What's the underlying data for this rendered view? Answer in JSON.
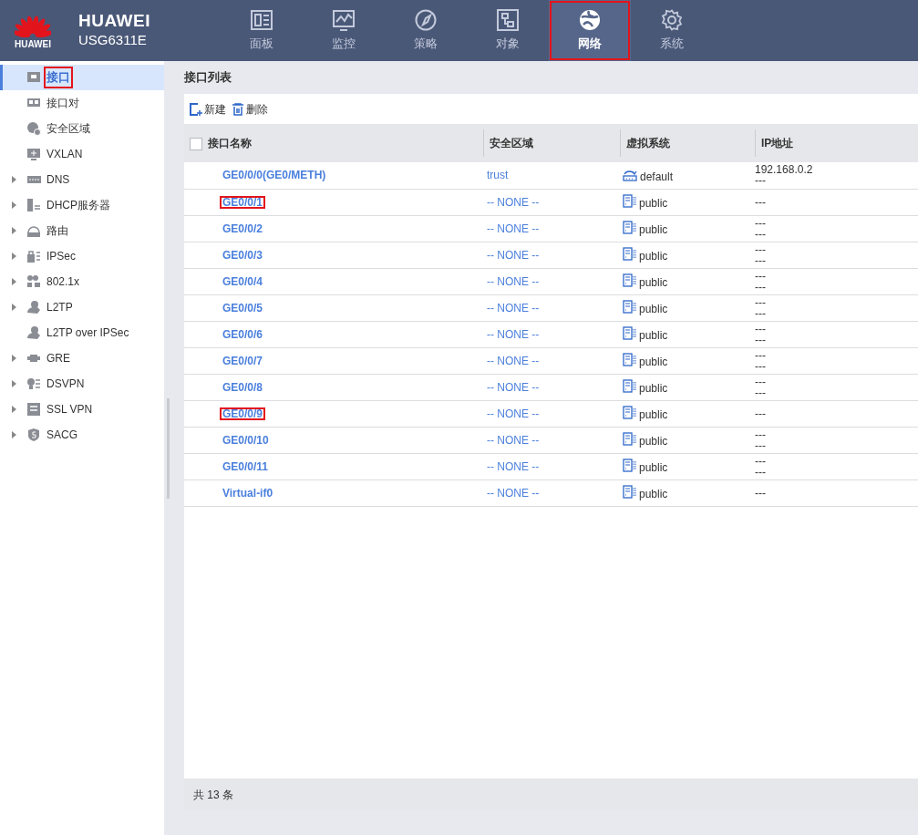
{
  "brand": {
    "logo_text": "HUAWEI",
    "name": "HUAWEI",
    "model": "USG6311E"
  },
  "nav": [
    {
      "label": "面板",
      "selected": false,
      "highlighted": false
    },
    {
      "label": "监控",
      "selected": false,
      "highlighted": false
    },
    {
      "label": "策略",
      "selected": false,
      "highlighted": false
    },
    {
      "label": "对象",
      "selected": false,
      "highlighted": false
    },
    {
      "label": "网络",
      "selected": true,
      "highlighted": true
    },
    {
      "label": "系统",
      "selected": false,
      "highlighted": false
    }
  ],
  "sidebar": {
    "items": [
      {
        "label": "接口",
        "kind": "item",
        "selected": true,
        "highlighted": true
      },
      {
        "label": "接口对",
        "kind": "item",
        "selected": false,
        "highlighted": false
      },
      {
        "label": "安全区域",
        "kind": "item",
        "selected": false,
        "highlighted": false
      },
      {
        "label": "VXLAN",
        "kind": "item",
        "selected": false,
        "highlighted": false
      },
      {
        "label": "DNS",
        "kind": "group",
        "expanded": false,
        "selected": false,
        "highlighted": false
      },
      {
        "label": "DHCP服务器",
        "kind": "group",
        "expanded": false,
        "selected": false,
        "highlighted": false
      },
      {
        "label": "路由",
        "kind": "group",
        "expanded": false,
        "selected": false,
        "highlighted": false
      },
      {
        "label": "IPSec",
        "kind": "group",
        "expanded": false,
        "selected": false,
        "highlighted": false
      },
      {
        "label": "802.1x",
        "kind": "group",
        "expanded": false,
        "selected": false,
        "highlighted": false
      },
      {
        "label": "L2TP",
        "kind": "group",
        "expanded": false,
        "selected": false,
        "highlighted": false
      },
      {
        "label": "L2TP over IPSec",
        "kind": "item",
        "selected": false,
        "highlighted": false
      },
      {
        "label": "GRE",
        "kind": "group",
        "expanded": false,
        "selected": false,
        "highlighted": false
      },
      {
        "label": "DSVPN",
        "kind": "group",
        "expanded": false,
        "selected": false,
        "highlighted": false
      },
      {
        "label": "SSL VPN",
        "kind": "group",
        "expanded": false,
        "selected": false,
        "highlighted": false
      },
      {
        "label": "SACG",
        "kind": "group",
        "expanded": false,
        "selected": false,
        "highlighted": false
      }
    ]
  },
  "panel": {
    "title": "接口列表",
    "toolbar": [
      "新建",
      "删除"
    ],
    "table": {
      "select_all": {
        "checked": false
      },
      "columns": [
        "接口名称",
        "安全区域",
        "虚拟系统",
        "IP地址"
      ],
      "rows": [
        {
          "name": "GE0/0/0(GE0/METH)",
          "zone": "trust",
          "vsys": "default",
          "kind": "root",
          "ip": [
            "192.168.0.2",
            "---"
          ],
          "highlighted": false
        },
        {
          "name": "GE0/0/1",
          "zone": "-- NONE --",
          "vsys": "public",
          "kind": "vsys",
          "ip": [
            "---"
          ],
          "highlighted": true
        },
        {
          "name": "GE0/0/2",
          "zone": "-- NONE --",
          "vsys": "public",
          "kind": "vsys",
          "ip": [
            "---",
            "---"
          ],
          "highlighted": false
        },
        {
          "name": "GE0/0/3",
          "zone": "-- NONE --",
          "vsys": "public",
          "kind": "vsys",
          "ip": [
            "---",
            "---"
          ],
          "highlighted": false
        },
        {
          "name": "GE0/0/4",
          "zone": "-- NONE --",
          "vsys": "public",
          "kind": "vsys",
          "ip": [
            "---",
            "---"
          ],
          "highlighted": false
        },
        {
          "name": "GE0/0/5",
          "zone": "-- NONE --",
          "vsys": "public",
          "kind": "vsys",
          "ip": [
            "---",
            "---"
          ],
          "highlighted": false
        },
        {
          "name": "GE0/0/6",
          "zone": "-- NONE --",
          "vsys": "public",
          "kind": "vsys",
          "ip": [
            "---",
            "---"
          ],
          "highlighted": false
        },
        {
          "name": "GE0/0/7",
          "zone": "-- NONE --",
          "vsys": "public",
          "kind": "vsys",
          "ip": [
            "---",
            "---"
          ],
          "highlighted": false
        },
        {
          "name": "GE0/0/8",
          "zone": "-- NONE --",
          "vsys": "public",
          "kind": "vsys",
          "ip": [
            "---",
            "---"
          ],
          "highlighted": false
        },
        {
          "name": "GE0/0/9",
          "zone": "-- NONE --",
          "vsys": "public",
          "kind": "vsys",
          "ip": [
            "---"
          ],
          "highlighted": true
        },
        {
          "name": "GE0/0/10",
          "zone": "-- NONE --",
          "vsys": "public",
          "kind": "vsys",
          "ip": [
            "---",
            "---"
          ],
          "highlighted": false
        },
        {
          "name": "GE0/0/11",
          "zone": "-- NONE --",
          "vsys": "public",
          "kind": "vsys",
          "ip": [
            "---",
            "---"
          ],
          "highlighted": false
        },
        {
          "name": "Virtual-if0",
          "zone": "-- NONE --",
          "vsys": "public",
          "kind": "vsys",
          "ip": [
            "---"
          ],
          "highlighted": false
        }
      ]
    },
    "footer": "共 13 条"
  }
}
